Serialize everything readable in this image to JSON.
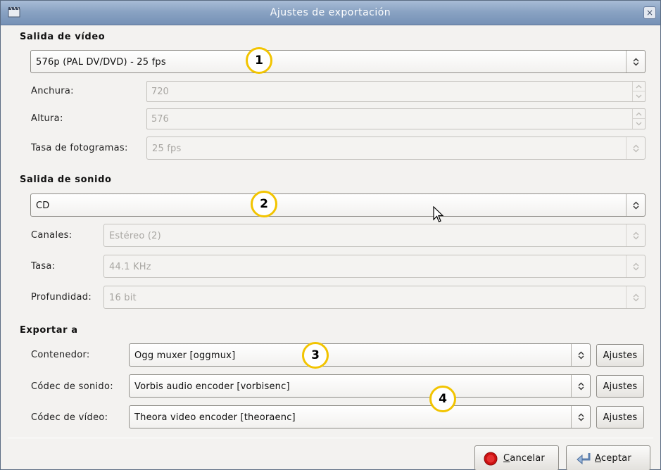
{
  "window": {
    "title": "Ajustes de exportación",
    "close_glyph": "×"
  },
  "video": {
    "section_title": "Salida de vídeo",
    "preset": "576p (PAL DV/DVD) - 25 fps",
    "width_label": "Anchura:",
    "width_value": "720",
    "height_label": "Altura:",
    "height_value": "576",
    "fps_label": "Tasa de fotogramas:",
    "fps_value": "25 fps"
  },
  "audio": {
    "section_title": "Salida de sonido",
    "preset": "CD",
    "channels_label": "Canales:",
    "channels_value": "Estéreo (2)",
    "rate_label": "Tasa:",
    "rate_value": "44.1 KHz",
    "depth_label": "Profundidad:",
    "depth_value": "16 bit"
  },
  "export": {
    "section_title": "Exportar a",
    "container_label": "Contenedor:",
    "container_value": "Ogg muxer [oggmux]",
    "audio_codec_label": "Códec de sonido:",
    "audio_codec_value": "Vorbis audio encoder [vorbisenc]",
    "video_codec_label": "Códec de vídeo:",
    "video_codec_value": "Theora video encoder [theoraenc]",
    "settings_label": "Ajustes"
  },
  "badges": [
    "1",
    "2",
    "3",
    "4"
  ],
  "footer": {
    "cancel_mnemonic": "C",
    "cancel_rest": "ancelar",
    "accept_mnemonic": "A",
    "accept_rest": "ceptar"
  },
  "colors": {
    "badge_border": "#f2c400",
    "titlebar": "#8aa3c3",
    "cancel_icon": "#cc1111"
  },
  "icons": [
    "app-icon",
    "close-icon",
    "cancel-icon",
    "accept-icon",
    "cursor-arrow-icon",
    "combo-arrow-icon",
    "spin-arrow-icon"
  ]
}
